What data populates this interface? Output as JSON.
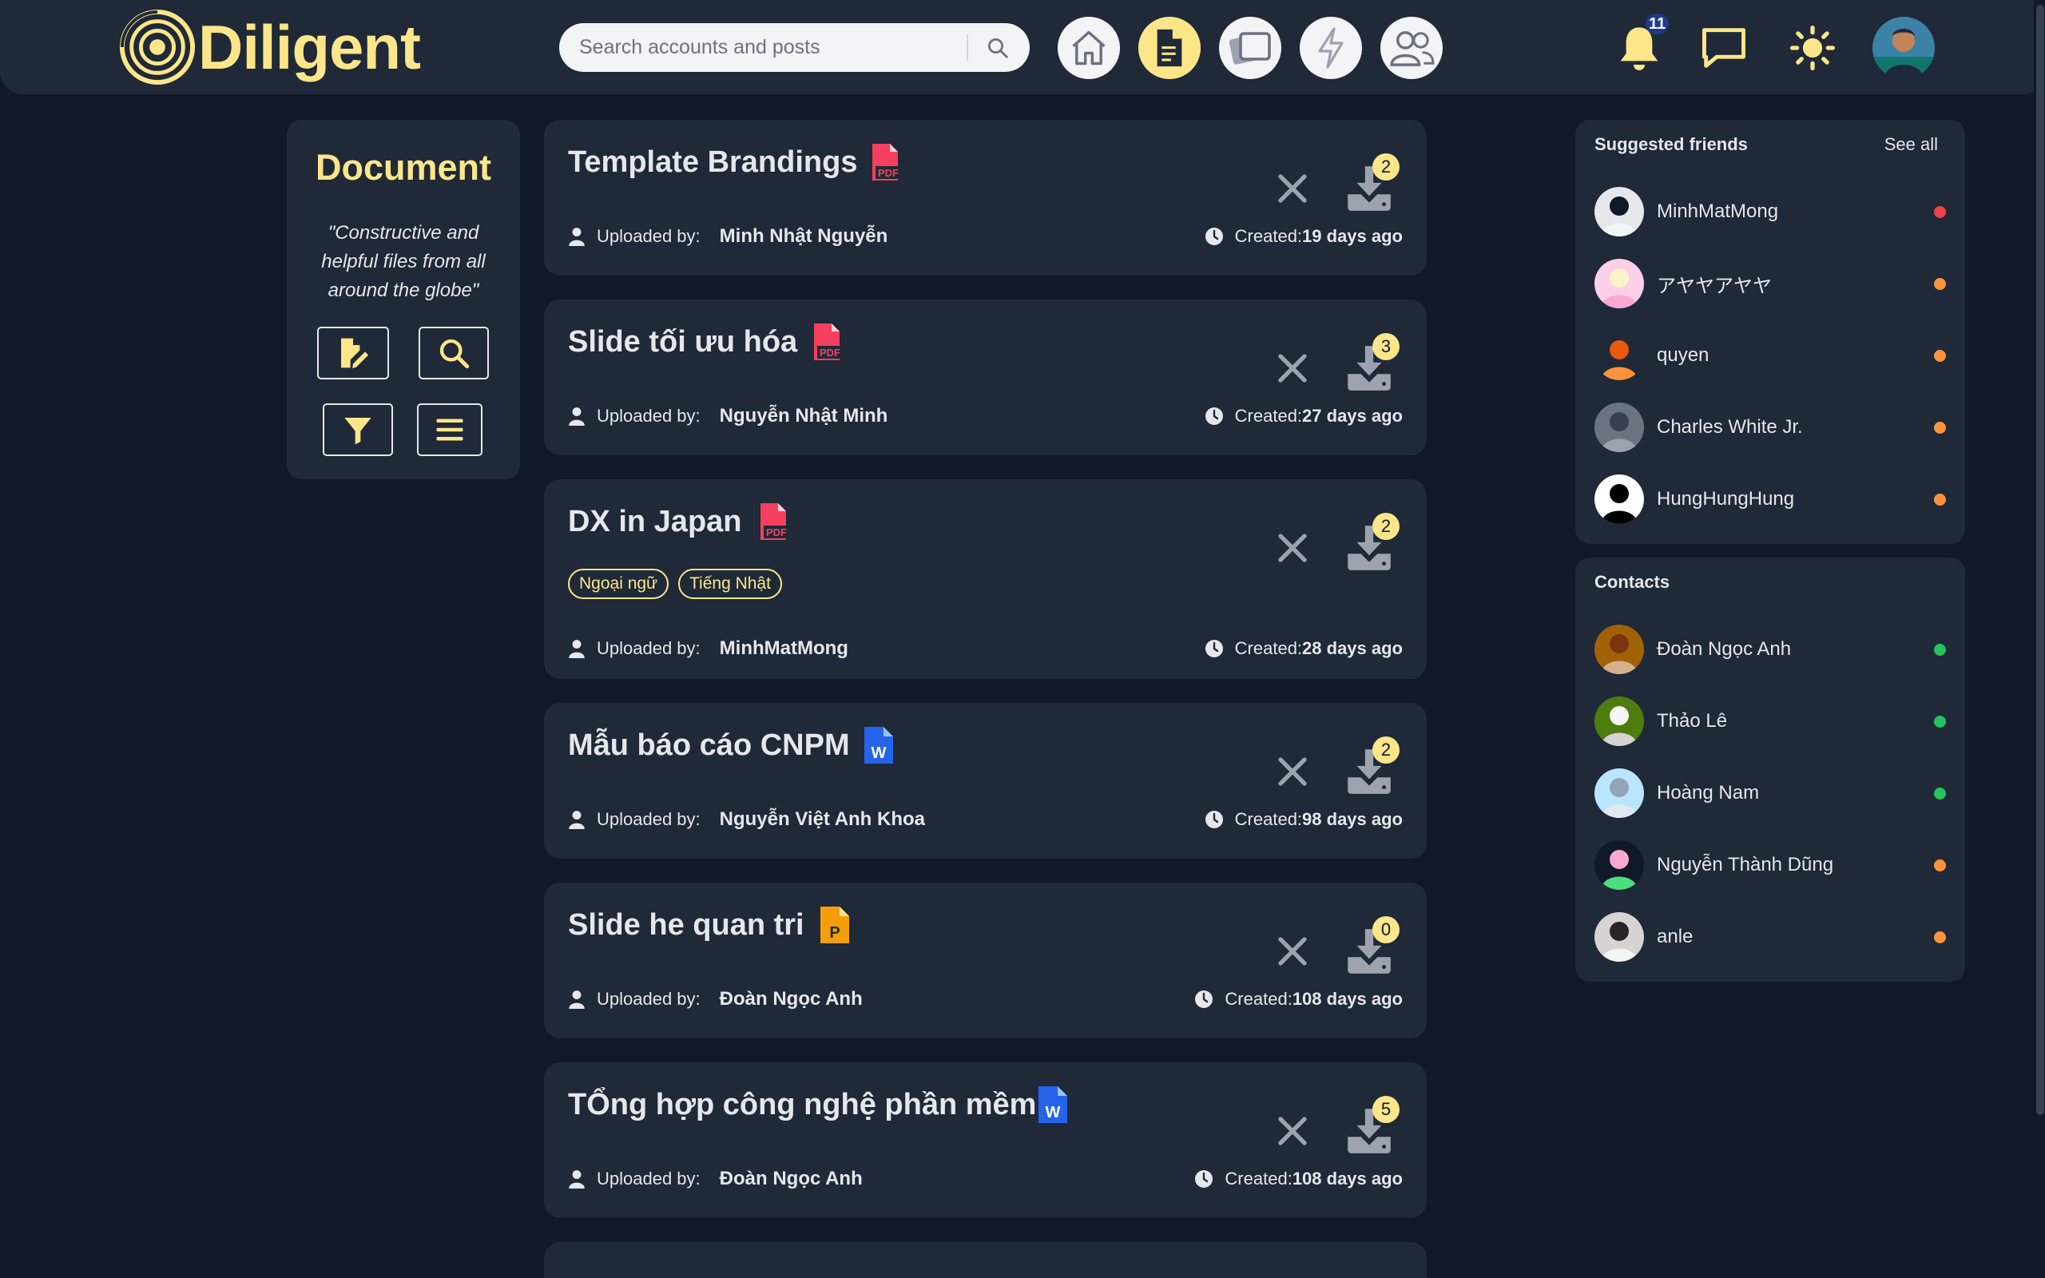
{
  "app": {
    "name": "Diligent"
  },
  "header": {
    "search_placeholder": "Search accounts and posts",
    "notification_count": "11",
    "nav": [
      "home-icon",
      "document-icon",
      "photos-icon",
      "lightning-icon",
      "friends-icon"
    ],
    "active_nav": "document-icon"
  },
  "colors": {
    "accent": "#fde68a",
    "background": "#111827",
    "panel": "#1f2937",
    "online": "#22c55e",
    "away": "#fb923c",
    "busy": "#ef4444"
  },
  "doc_panel": {
    "title": "Document",
    "quote": "\"Constructive and helpful files from all around the globe\"",
    "tools": [
      "upload-document-icon",
      "search-icon",
      "filter-icon",
      "menu-icon"
    ]
  },
  "labels": {
    "uploaded_by": "Uploaded by:",
    "created": "Created:"
  },
  "documents": [
    {
      "title": "Template Brandings",
      "type": "pdf",
      "tags": [],
      "uploader": "Minh Nhật Nguyễn",
      "created": "19 days ago",
      "downloads": "2"
    },
    {
      "title": "Slide tối ưu hóa",
      "type": "pdf",
      "tags": [],
      "uploader": "Nguyễn Nhật Minh",
      "created": "27 days ago",
      "downloads": "3"
    },
    {
      "title": "DX in Japan",
      "type": "pdf",
      "tags": [
        "Ngoại ngữ",
        "Tiếng Nhật"
      ],
      "uploader": "MinhMatMong",
      "created": "28 days ago",
      "downloads": "2"
    },
    {
      "title": "Mẫu báo cáo CNPM",
      "type": "word",
      "tags": [],
      "uploader": "Nguyễn Việt Anh Khoa",
      "created": "98 days ago",
      "downloads": "2"
    },
    {
      "title": "Slide he quan tri",
      "type": "powerpoint",
      "tags": [],
      "uploader": "Đoàn Ngọc Anh",
      "created": "108 days ago",
      "downloads": "0"
    },
    {
      "title": "TỔng hợp công nghệ phần mềm",
      "type": "word",
      "tags": [],
      "uploader": "Đoàn Ngọc Anh",
      "created": "108 days ago",
      "downloads": "5"
    }
  ],
  "suggested": {
    "title": "Suggested friends",
    "see_all": "See all",
    "people": [
      {
        "name": "MinhMatMong",
        "status": "busy"
      },
      {
        "name": "アヤヤアヤヤ",
        "status": "away"
      },
      {
        "name": "quyen",
        "status": "away"
      },
      {
        "name": "Charles White Jr.",
        "status": "away"
      },
      {
        "name": "HungHungHung",
        "status": "away"
      }
    ]
  },
  "contacts": {
    "title": "Contacts",
    "people": [
      {
        "name": "Đoàn Ngọc Anh",
        "status": "online"
      },
      {
        "name": "Thảo Lê",
        "status": "online"
      },
      {
        "name": "Hoàng Nam",
        "status": "online"
      },
      {
        "name": "Nguyễn Thành Dũng",
        "status": "away"
      },
      {
        "name": "anle",
        "status": "away"
      }
    ]
  }
}
